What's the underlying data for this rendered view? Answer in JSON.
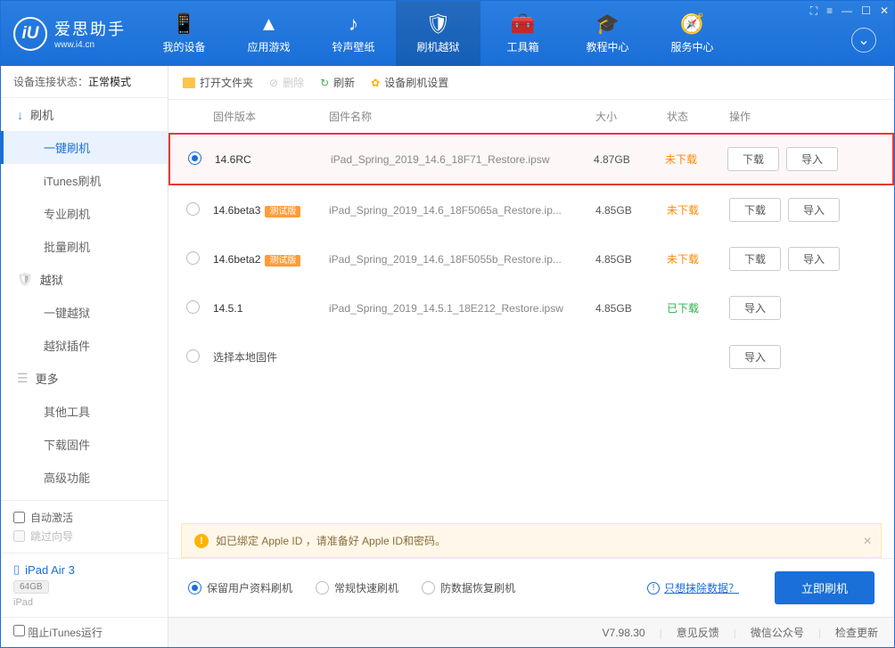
{
  "header": {
    "logo_title": "爱思助手",
    "logo_url": "www.i4.cn",
    "nav": [
      {
        "icon": "📱",
        "label": "我的设备"
      },
      {
        "icon": "▲",
        "label": "应用游戏"
      },
      {
        "icon": "♪",
        "label": "铃声壁纸"
      },
      {
        "icon": "🛡",
        "label": "刷机越狱"
      },
      {
        "icon": "🧰",
        "label": "工具箱"
      },
      {
        "icon": "🎓",
        "label": "教程中心"
      },
      {
        "icon": "🧭",
        "label": "服务中心"
      }
    ]
  },
  "sidebar": {
    "status_label": "设备连接状态：",
    "status_mode": "正常模式",
    "groups": [
      {
        "icon": "↓",
        "label": "刷机",
        "subs": [
          "一键刷机",
          "iTunes刷机",
          "专业刷机",
          "批量刷机"
        ]
      },
      {
        "icon": "🛡",
        "label": "越狱",
        "subs": [
          "一键越狱",
          "越狱插件"
        ],
        "grey": true
      },
      {
        "icon": "☰",
        "label": "更多",
        "subs": [
          "其他工具",
          "下载固件",
          "高级功能"
        ],
        "grey": true
      }
    ],
    "auto_activate": "自动激活",
    "skip_guide": "跳过向导",
    "device_name": "iPad Air 3",
    "device_storage": "64GB",
    "device_type": "iPad",
    "block_itunes": "阻止iTunes运行"
  },
  "toolbar": {
    "open": "打开文件夹",
    "delete": "删除",
    "refresh": "刷新",
    "settings": "设备刷机设置"
  },
  "table": {
    "head_ver": "固件版本",
    "head_name": "固件名称",
    "head_size": "大小",
    "head_status": "状态",
    "head_ops": "操作",
    "btn_download": "下载",
    "btn_import": "导入",
    "badge_beta": "测试版",
    "choose_local": "选择本地固件",
    "rows": [
      {
        "ver": "14.6RC",
        "name": "iPad_Spring_2019_14.6_18F71_Restore.ipsw",
        "size": "4.87GB",
        "status": "未下载",
        "downloaded": false,
        "beta": false,
        "selected": true
      },
      {
        "ver": "14.6beta3",
        "name": "iPad_Spring_2019_14.6_18F5065a_Restore.ip...",
        "size": "4.85GB",
        "status": "未下载",
        "downloaded": false,
        "beta": true,
        "selected": false
      },
      {
        "ver": "14.6beta2",
        "name": "iPad_Spring_2019_14.6_18F5055b_Restore.ip...",
        "size": "4.85GB",
        "status": "未下载",
        "downloaded": false,
        "beta": true,
        "selected": false
      },
      {
        "ver": "14.5.1",
        "name": "iPad_Spring_2019_14.5.1_18E212_Restore.ipsw",
        "size": "4.85GB",
        "status": "已下载",
        "downloaded": true,
        "beta": false,
        "selected": false
      }
    ]
  },
  "notice": "如已绑定 Apple ID ，请准备好 Apple ID和密码。",
  "options": {
    "keep_data": "保留用户资料刷机",
    "normal": "常规快速刷机",
    "anti_recovery": "防数据恢复刷机",
    "hint": "只想抹除数据？",
    "flash_now": "立即刷机"
  },
  "statusbar": {
    "version": "V7.98.30",
    "feedback": "意见反馈",
    "wechat": "微信公众号",
    "update": "检查更新"
  }
}
